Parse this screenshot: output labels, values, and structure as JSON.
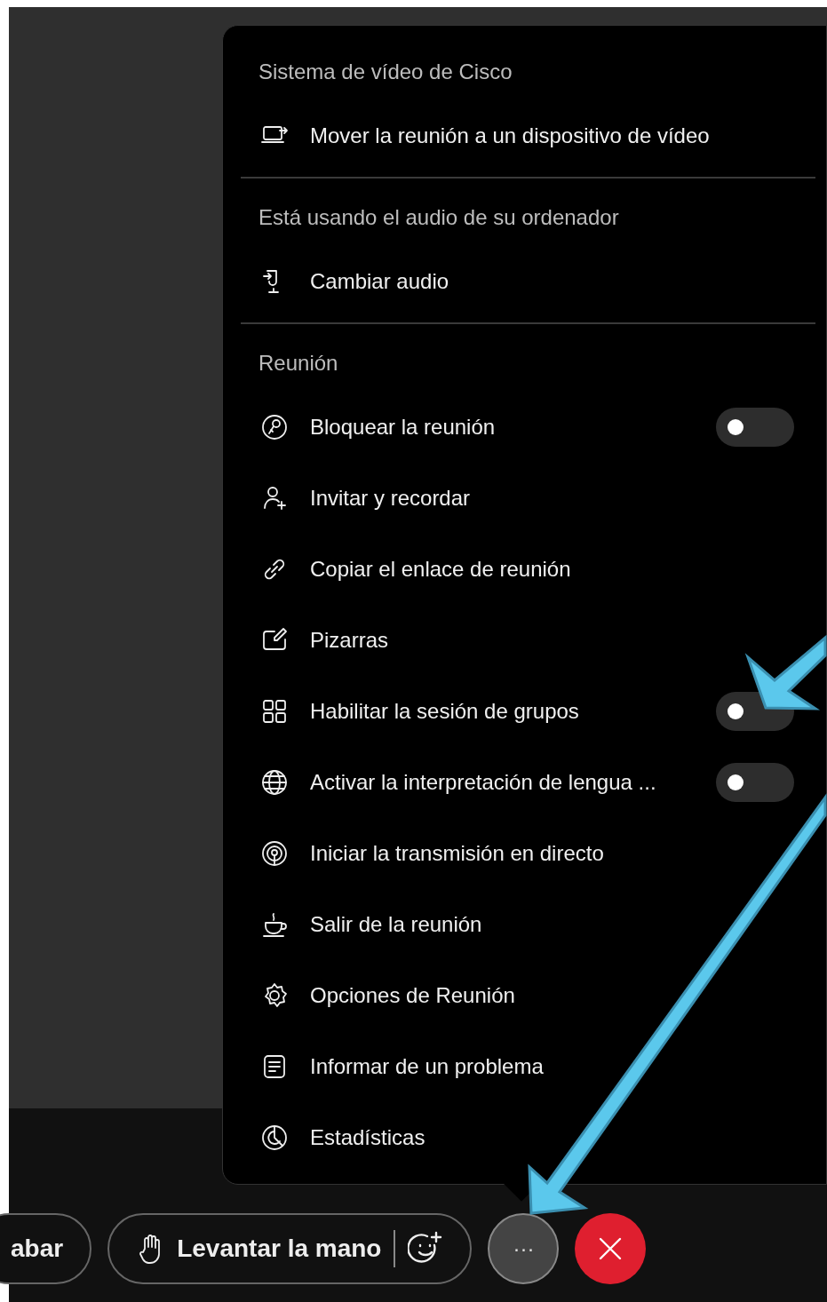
{
  "menu": {
    "sections": [
      {
        "title": "Sistema de vídeo de Cisco",
        "items": [
          {
            "kind": "action",
            "label": "Mover la reunión a un dispositivo de vídeo"
          }
        ]
      },
      {
        "title": "Está usando el audio de su ordenador",
        "items": [
          {
            "kind": "action",
            "label": "Cambiar audio"
          }
        ]
      },
      {
        "title": "Reunión",
        "items": [
          {
            "kind": "toggle",
            "label": "Bloquear la reunión",
            "on": false
          },
          {
            "kind": "action",
            "label": "Invitar y recordar"
          },
          {
            "kind": "action",
            "label": "Copiar el enlace de reunión"
          },
          {
            "kind": "action",
            "label": "Pizarras"
          },
          {
            "kind": "toggle",
            "label": "Habilitar la sesión de grupos",
            "on": false
          },
          {
            "kind": "toggle",
            "label": "Activar la interpretación de lengua ...",
            "on": false
          },
          {
            "kind": "action",
            "label": "Iniciar la transmisión en directo"
          },
          {
            "kind": "action",
            "label": "Salir de la reunión"
          },
          {
            "kind": "action",
            "label": "Opciones de Reunión"
          },
          {
            "kind": "action",
            "label": "Informar de un problema"
          },
          {
            "kind": "action",
            "label": "Estadísticas"
          }
        ]
      }
    ]
  },
  "toolbar": {
    "record_button": "abar",
    "raise_hand_button": "Levantar la mano",
    "more_button": "···"
  }
}
